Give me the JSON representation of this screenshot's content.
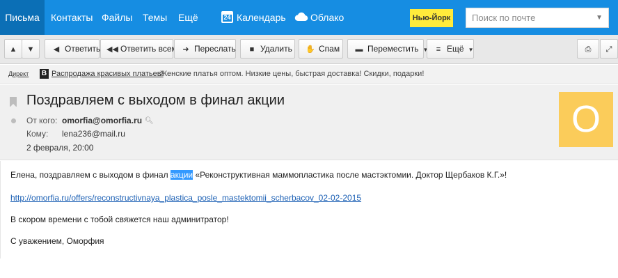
{
  "nav": {
    "items": [
      {
        "label": "Письма",
        "active": true
      },
      {
        "label": "Контакты"
      },
      {
        "label": "Файлы"
      },
      {
        "label": "Темы"
      },
      {
        "label": "Ещё"
      }
    ],
    "calendar_label": "Календарь",
    "calendar_day": "24",
    "cloud_label": "Облако",
    "city": "Нью-Йорк",
    "search_placeholder": "Поиск по почте",
    "colors": {
      "bar": "#168de2",
      "active": "#0b6fb6",
      "city_badge": "#ffeb3b"
    }
  },
  "toolbar": {
    "reply": "Ответить",
    "reply_all": "Ответить всем",
    "forward": "Переслать",
    "delete": "Удалить",
    "spam": "Спам",
    "move": "Переместить",
    "more": "Ещё",
    "icons": [
      "arrow-up-icon",
      "arrow-down-icon",
      "reply-icon",
      "reply-all-icon",
      "forward-icon",
      "trash-icon",
      "thumb-down-icon",
      "folder-icon",
      "menu-icon",
      "print-icon",
      "expand-icon"
    ]
  },
  "ad": {
    "label": "Директ",
    "logo_letter": "В",
    "link": "Распродажа красивых платьев!",
    "text": "Женские платья оптом. Низкие цены, быстрая доставка! Скидки, подарки!"
  },
  "message": {
    "subject": "Поздравляем с выходом в финал акции",
    "from_label": "От кого:",
    "from": "omorfia@omorfia.ru",
    "to_label": "Кому:",
    "to": "lena236@mail.ru",
    "date": "2 февраля, 20:00",
    "avatar_letter": "O",
    "avatar_color": "#fbcc5a"
  },
  "body": {
    "p1_before": "Елена, поздравляем с выходом в финал ",
    "p1_highlight": "акции",
    "p1_after": " «Реконструктивная маммопластика после мастэктомии. Доктор Щербаков К.Г.»!",
    "link": "http://omorfia.ru/offers/reconstructivnaya_plastica_posle_mastektomii_scherbacov_02-02-2015",
    "p2": "В скором времени с тобой свяжется наш админитратор!",
    "p3": "С уважением, Оморфия"
  }
}
